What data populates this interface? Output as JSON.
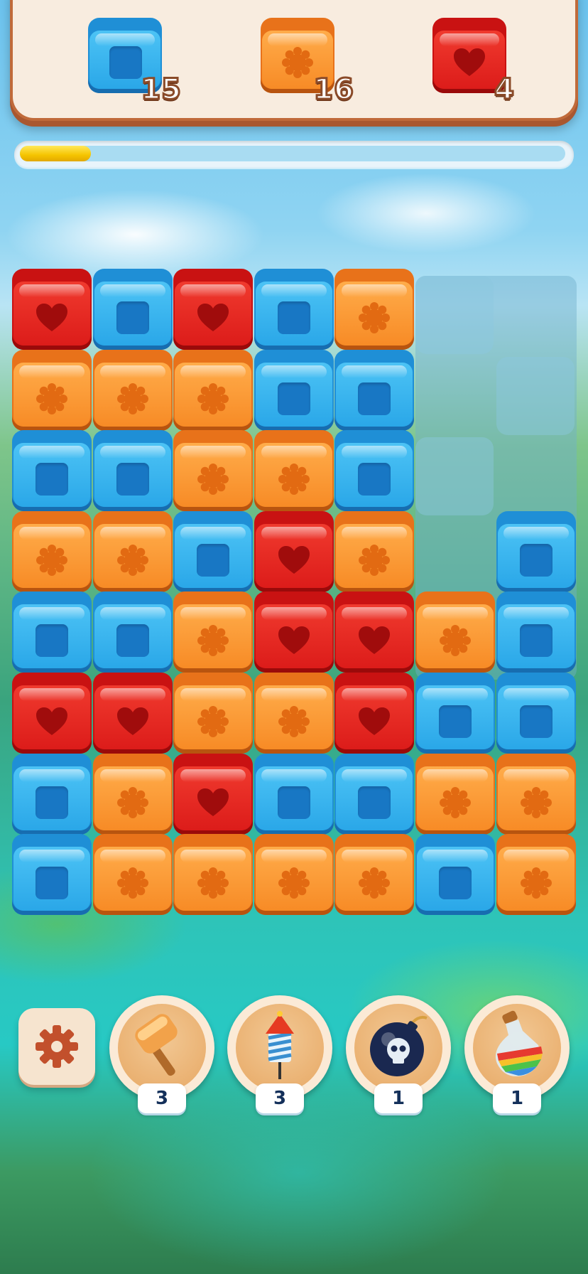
{
  "goals": [
    {
      "type": "blue-square",
      "count": "15"
    },
    {
      "type": "orange-flower",
      "count": "16"
    },
    {
      "type": "red-heart",
      "count": "4"
    }
  ],
  "progress": {
    "fraction": 0.13
  },
  "board": {
    "rows": [
      [
        "R",
        "B",
        "R",
        "B",
        "O",
        null,
        null
      ],
      [
        "O",
        "O",
        "O",
        "B",
        "B",
        null,
        null
      ],
      [
        "B",
        "B",
        "O",
        "O",
        "B",
        null,
        null
      ],
      [
        "O",
        "O",
        "B",
        "R",
        "O",
        null,
        "B"
      ],
      [
        "B",
        "B",
        "O",
        "R",
        "R",
        "O",
        "B"
      ],
      [
        "R",
        "R",
        "O",
        "O",
        "R",
        "B",
        "B"
      ],
      [
        "B",
        "O",
        "R",
        "B",
        "B",
        "O",
        "O"
      ],
      [
        "B",
        "O",
        "O",
        "O",
        "O",
        "B",
        "O"
      ]
    ]
  },
  "toolbar": {
    "settings_icon": "gear-icon",
    "boosters": [
      {
        "name": "hammer",
        "icon": "hammer-icon",
        "count": "3"
      },
      {
        "name": "rocket",
        "icon": "rocket-icon",
        "count": "3"
      },
      {
        "name": "bomb",
        "icon": "bomb-icon",
        "count": "1"
      },
      {
        "name": "rainbow-potion",
        "icon": "potion-icon",
        "count": "1"
      }
    ]
  },
  "colors": {
    "blue": "#2aa7e8",
    "orange": "#f78b26",
    "red": "#dc1c1a",
    "progress": "#f5c400"
  }
}
